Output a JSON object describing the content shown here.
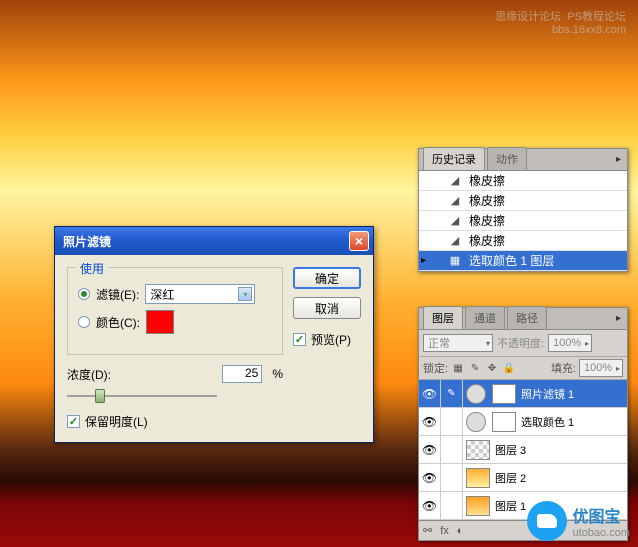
{
  "watermark": {
    "top1": "思缘设计论坛",
    "top2": "PS教程论坛",
    "top3": "bbs.16xx8.com",
    "brand": "优图宝",
    "url": "utobao.com"
  },
  "dialog": {
    "title": "照片滤镜",
    "use_label": "使用",
    "filter_label": "滤镜(E):",
    "filter_value": "深红",
    "color_label": "颜色(C):",
    "density_label": "浓度(D):",
    "density_value": "25",
    "density_unit": "%",
    "preserve_label": "保留明度(L)",
    "ok": "确定",
    "cancel": "取消",
    "preview": "预览(P)"
  },
  "history": {
    "tab1": "历史记录",
    "tab2": "动作",
    "items": [
      {
        "label": "橡皮擦",
        "icon": "eraser"
      },
      {
        "label": "橡皮擦",
        "icon": "eraser"
      },
      {
        "label": "橡皮擦",
        "icon": "eraser"
      },
      {
        "label": "橡皮擦",
        "icon": "eraser"
      },
      {
        "label": "选取颜色 1 图层",
        "icon": "layer",
        "selected": true
      }
    ]
  },
  "layers": {
    "tab1": "图层",
    "tab2": "通道",
    "tab3": "路径",
    "blend": "正常",
    "opacity_label": "不透明度:",
    "opacity_value": "100%",
    "lock_label": "锁定:",
    "fill_label": "填充:",
    "fill_value": "100%",
    "items": [
      {
        "name": "照片滤镜 1",
        "selected": true,
        "thumb": "adjust",
        "mask": true
      },
      {
        "name": "选取颜色 1",
        "thumb": "adjust",
        "mask": true
      },
      {
        "name": "图层 3",
        "thumb": "checker"
      },
      {
        "name": "图层 2",
        "thumb": "sky1"
      },
      {
        "name": "图层 1",
        "thumb": "sky2"
      }
    ]
  }
}
